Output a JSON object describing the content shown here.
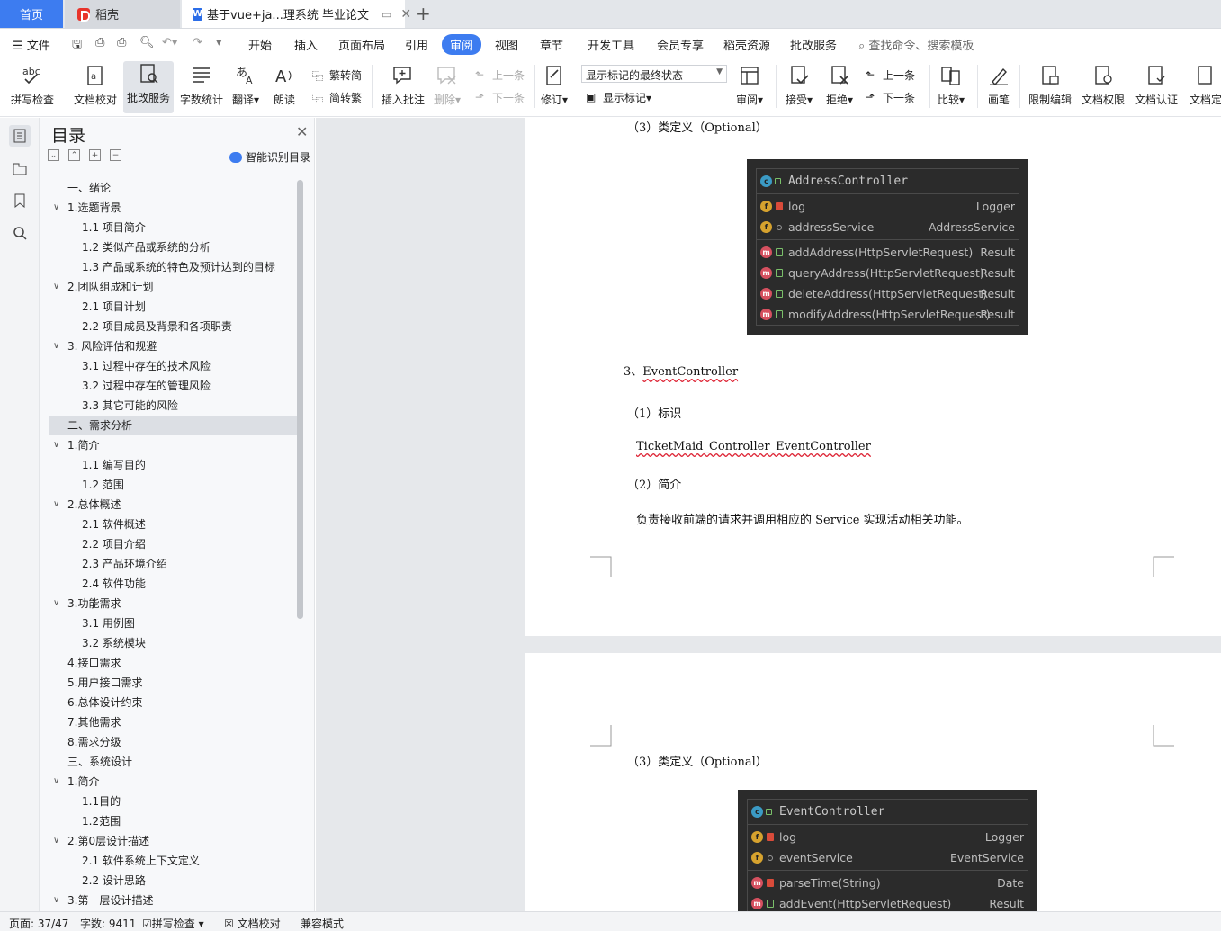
{
  "tabs": {
    "home": "首页",
    "daoke": "稻壳",
    "doc": "基于vue+ja...理系统 毕业论文"
  },
  "menu": {
    "file": "文件",
    "items": [
      "开始",
      "插入",
      "页面布局",
      "引用",
      "审阅",
      "视图",
      "章节",
      "开发工具",
      "会员专享",
      "稻壳资源",
      "批改服务"
    ],
    "active": "审阅",
    "search": "查找命令、搜索模板"
  },
  "ribbon": {
    "spell": "拼写检查",
    "proof": "文档校对",
    "correct": "批改服务",
    "wordcount": "字数统计",
    "translate": "翻译",
    "read": "朗读",
    "trad": "繁转简",
    "simp": "简转繁",
    "insert_comment": "插入批注",
    "delete": "删除",
    "prev_comment": "上一条",
    "next_comment": "下一条",
    "revise": "修订",
    "markup_state": "显示标记的最终状态",
    "show_markup": "显示标记",
    "review": "审阅",
    "accept": "接受",
    "reject": "拒绝",
    "prev": "上一条",
    "next": "下一条",
    "compare": "比较",
    "pen": "画笔",
    "restrict": "限制编辑",
    "permission": "文档权限",
    "certify": "文档认证",
    "finalize": "文档定"
  },
  "toc": {
    "title": "目录",
    "smart": "智能识别目录",
    "items": [
      {
        "text": "一、绪论",
        "level": 0,
        "arrow": false
      },
      {
        "text": "1.选题背景",
        "level": 0,
        "arrow": true
      },
      {
        "text": "1.1  项目简介",
        "level": 1,
        "arrow": false
      },
      {
        "text": "1.2  类似产品或系统的分析",
        "level": 1,
        "arrow": false
      },
      {
        "text": "1.3  产品或系统的特色及预计达到的目标",
        "level": 1,
        "arrow": false
      },
      {
        "text": "2.团队组成和计划",
        "level": 0,
        "arrow": true
      },
      {
        "text": "2.1 项目计划",
        "level": 1,
        "arrow": false
      },
      {
        "text": "2.2  项目成员及背景和各项职责",
        "level": 1,
        "arrow": false
      },
      {
        "text": "3.  风险评估和规避",
        "level": 0,
        "arrow": true
      },
      {
        "text": "3.1  过程中存在的技术风险",
        "level": 1,
        "arrow": false
      },
      {
        "text": "3.2  过程中存在的管理风险",
        "level": 1,
        "arrow": false
      },
      {
        "text": "3.3  其它可能的风险",
        "level": 1,
        "arrow": false
      },
      {
        "text": "二、需求分析",
        "level": 0,
        "arrow": false,
        "selected": true
      },
      {
        "text": "1.简介",
        "level": 0,
        "arrow": true
      },
      {
        "text": "1.1  编写目的",
        "level": 1,
        "arrow": false
      },
      {
        "text": "1.2  范围",
        "level": 1,
        "arrow": false
      },
      {
        "text": "2.总体概述",
        "level": 0,
        "arrow": true
      },
      {
        "text": "2.1  软件概述",
        "level": 1,
        "arrow": false
      },
      {
        "text": "2.2  项目介绍",
        "level": 1,
        "arrow": false
      },
      {
        "text": "2.3  产品环境介绍",
        "level": 1,
        "arrow": false
      },
      {
        "text": "2.4  软件功能",
        "level": 1,
        "arrow": false
      },
      {
        "text": "3.功能需求",
        "level": 0,
        "arrow": true
      },
      {
        "text": "3.1  用例图",
        "level": 1,
        "arrow": false
      },
      {
        "text": "3.2  系统模块",
        "level": 1,
        "arrow": false
      },
      {
        "text": "4.接口需求",
        "level": 0,
        "arrow": false
      },
      {
        "text": "5.用户接口需求",
        "level": 0,
        "arrow": false
      },
      {
        "text": "6.总体设计约束",
        "level": 0,
        "arrow": false
      },
      {
        "text": "7.其他需求",
        "level": 0,
        "arrow": false
      },
      {
        "text": "8.需求分级",
        "level": 0,
        "arrow": false
      },
      {
        "text": "三、系统设计",
        "level": 0,
        "arrow": false
      },
      {
        "text": "1.简介",
        "level": 0,
        "arrow": true
      },
      {
        "text": "1.1目的",
        "level": 1,
        "arrow": false
      },
      {
        "text": "1.2范围",
        "level": 1,
        "arrow": false
      },
      {
        "text": "2.第0层设计描述",
        "level": 0,
        "arrow": true
      },
      {
        "text": "2.1  软件系统上下文定义",
        "level": 1,
        "arrow": false
      },
      {
        "text": "2.2  设计思路",
        "level": 1,
        "arrow": false
      },
      {
        "text": "3.第一层设计描述",
        "level": 0,
        "arrow": true
      }
    ]
  },
  "doc": {
    "p1_heading": "（3）类定义（Optional）",
    "uml1": {
      "name": "AddressController",
      "fields": [
        {
          "name": "log",
          "type": "Logger",
          "vis": "lock"
        },
        {
          "name": "addressService",
          "type": "AddressService",
          "vis": "circle"
        }
      ],
      "methods": [
        {
          "name": "addAddress(HttpServletRequest)",
          "type": "Result"
        },
        {
          "name": "queryAddress(HttpServletRequest)",
          "type": "Result"
        },
        {
          "name": "deleteAddress(HttpServletRequest)",
          "type": "Result"
        },
        {
          "name": "modifyAddress(HttpServletRequest)",
          "type": "Result"
        }
      ]
    },
    "sec3_prefix": "3、",
    "sec3_name": "EventController",
    "id_heading": "（1）标识",
    "id_value": "TicketMaid_Controller_EventController",
    "intro_heading": "（2）简介",
    "intro_text": "负责接收前端的请求并调用相应的 Service 实现活动相关功能。",
    "p2_heading": "（3）类定义（Optional）",
    "uml2": {
      "name": "EventController",
      "fields": [
        {
          "name": "log",
          "type": "Logger",
          "vis": "lock"
        },
        {
          "name": "eventService",
          "type": "EventService",
          "vis": "circle"
        }
      ],
      "methods": [
        {
          "name": "parseTime(String)",
          "type": "Date",
          "vis": "lock"
        },
        {
          "name": "addEvent(HttpServletRequest)",
          "type": "Result",
          "vis": "open"
        }
      ]
    }
  },
  "status": {
    "page": "页面: 37/47",
    "words": "字数: 9411",
    "spell": "拼写检查",
    "proof": "文档校对",
    "compat": "兼容模式"
  }
}
